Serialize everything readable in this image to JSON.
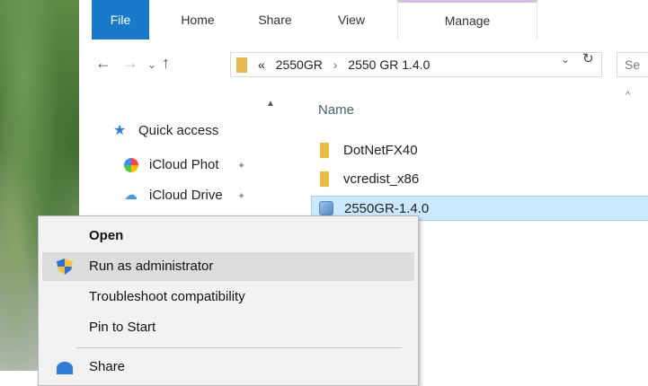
{
  "ribbon": {
    "tabs": [
      "File",
      "Home",
      "Share",
      "View",
      "Manage"
    ]
  },
  "navigation": {
    "back_icon": "←",
    "forward_icon": "→",
    "recent_icon": "⌄",
    "up_icon": "↑",
    "address_overflow": "«",
    "address_parts": [
      "2550GR",
      "2550 GR 1.4.0"
    ],
    "address_separator": "›",
    "dropdown_icon": "⌄",
    "refresh_icon": "↻",
    "search_placeholder": "Se"
  },
  "nav_pane": {
    "scroll_up_icon": "▲",
    "items": [
      {
        "label": "Quick access",
        "icon": "star-icon"
      },
      {
        "label": "iCloud Phot",
        "icon": "photos-icon",
        "pinned": true
      },
      {
        "label": "iCloud Drive",
        "icon": "cloud-icon",
        "pinned": true
      }
    ],
    "pin_glyph": "📌"
  },
  "file_list": {
    "column_header": "Name",
    "sort_icon": "^",
    "files": [
      {
        "name": "DotNetFX40",
        "type": "folder"
      },
      {
        "name": "vcredist_x86",
        "type": "folder"
      },
      {
        "name": "2550GR-1.4.0",
        "type": "application",
        "selected": true
      }
    ]
  },
  "context_menu": {
    "items": [
      {
        "label": "Open",
        "bold": true
      },
      {
        "label": "Run as administrator",
        "icon": "shield-icon",
        "highlighted": true
      },
      {
        "label": "Troubleshoot compatibility"
      },
      {
        "label": "Pin to Start"
      },
      {
        "label": "Share",
        "icon": "share-icon"
      }
    ]
  },
  "colors": {
    "file_tab": "#1979ca",
    "selection": "#cce8ff",
    "manage_accent": "#d8bde8",
    "menu_bg": "#f2f2f2",
    "menu_hover": "#dcdcdc"
  }
}
